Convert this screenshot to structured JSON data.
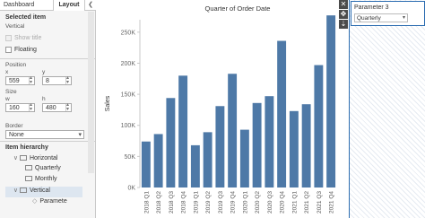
{
  "tabs": {
    "dashboard": "Dashboard",
    "layout": "Layout",
    "collapse": "❮"
  },
  "left": {
    "selected_item_heading": "Selected item",
    "selected_item_value": "Vertical",
    "show_title": "Show title",
    "floating": "Floating",
    "position_heading": "Position",
    "x_label": "x",
    "x_value": "559",
    "y_label": "y",
    "y_value": "8",
    "size_heading": "Size",
    "w_label": "w",
    "w_value": "160",
    "h_label": "h",
    "h_value": "480",
    "border_heading": "Border",
    "border_value": "None",
    "hierarchy_heading": "Item hierarchy",
    "tree": [
      {
        "label": "Horizontal",
        "expander": "∨"
      },
      {
        "label": "Quarterly",
        "expander": ""
      },
      {
        "label": "Monthly",
        "expander": ""
      },
      {
        "label": "Vertical",
        "expander": "∨"
      },
      {
        "label": "Paramete",
        "expander": ""
      }
    ]
  },
  "toolbar": {
    "close": "✕",
    "move": "✥",
    "fit": "⇣",
    "menu": "▾"
  },
  "parameter": {
    "title": "Parameter 3",
    "value": "Quarterly",
    "arrow": "▾"
  },
  "chart_data": {
    "type": "bar",
    "title": "Quarter of Order Date",
    "ylabel": "Sales",
    "xlabel": "",
    "ylim": [
      0,
      270000
    ],
    "yticks": [
      0,
      50000,
      100000,
      150000,
      200000,
      250000
    ],
    "ytick_labels": [
      "0K",
      "50K",
      "100K",
      "150K",
      "200K",
      "250K"
    ],
    "color": "#4e79a7",
    "categories": [
      "2018 Q1",
      "2018 Q2",
      "2018 Q3",
      "2018 Q4",
      "2019 Q1",
      "2019 Q2",
      "2019 Q3",
      "2019 Q4",
      "2020 Q1",
      "2020 Q2",
      "2020 Q3",
      "2020 Q4",
      "2021 Q1",
      "2021 Q2",
      "2021 Q3",
      "2021 Q4"
    ],
    "values": [
      74000,
      86000,
      144000,
      180000,
      68000,
      89000,
      131000,
      183000,
      93000,
      136000,
      147000,
      236000,
      123000,
      134000,
      197000,
      277000
    ]
  }
}
